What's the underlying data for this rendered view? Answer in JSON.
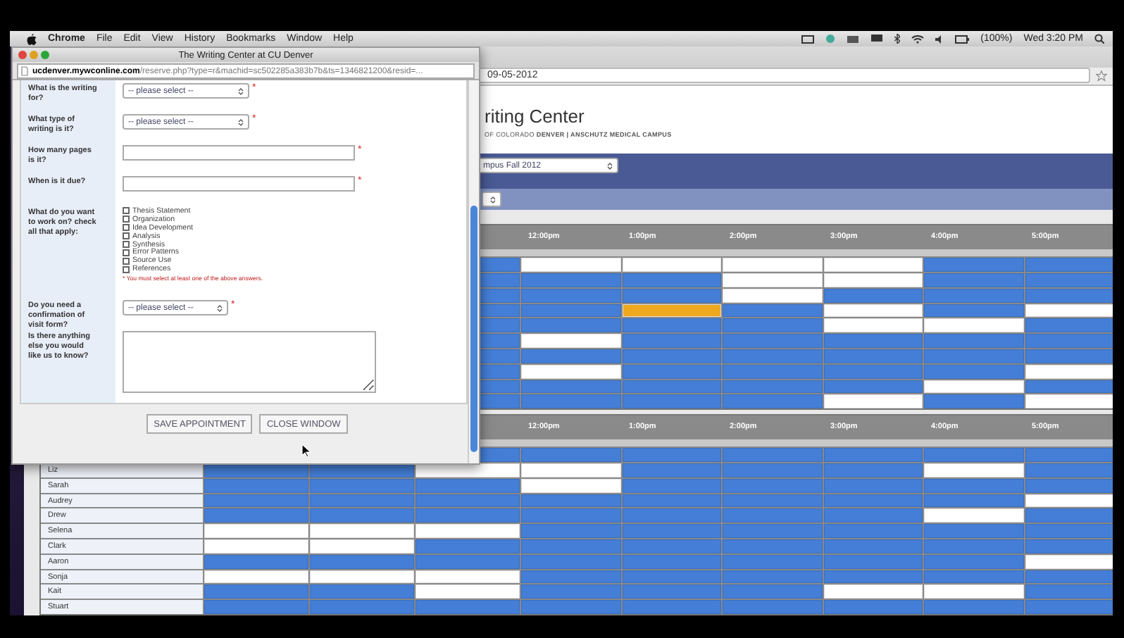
{
  "menu_bar": {
    "app": "Chrome",
    "menus": [
      "File",
      "Edit",
      "View",
      "History",
      "Bookmarks",
      "Window",
      "Help"
    ],
    "battery": "(100%)",
    "clock": "Wed 3:20 PM"
  },
  "browser": {
    "address_fragment": "09-05-2012",
    "title": "riting Center",
    "subtitle": "OF COLORADO **DENVER | ANSCHUTZ MEDICAL CAMPUS**",
    "term_select": "mpus Fall 2012"
  },
  "grids": [
    {
      "times": [
        "12:00pm",
        "1:00pm",
        "2:00pm",
        "3:00pm",
        "4:00pm",
        "5:00pm"
      ],
      "rows": [
        {
          "slots": [
            {
              "booked": true,
              "selected": false
            },
            {
              "booked": false,
              "selected": false
            },
            {
              "booked": false,
              "selected": false
            },
            {
              "booked": false,
              "selected": false
            },
            {
              "booked": false,
              "selected": false
            },
            {
              "booked": true,
              "selected": false
            },
            {
              "booked": true,
              "selected": false
            }
          ]
        },
        {
          "slots": [
            {
              "booked": true,
              "selected": false
            },
            {
              "booked": true,
              "selected": false
            },
            {
              "booked": true,
              "selected": false
            },
            {
              "booked": false,
              "selected": false
            },
            {
              "booked": false,
              "selected": false
            },
            {
              "booked": true,
              "selected": false
            },
            {
              "booked": true,
              "selected": false
            }
          ]
        },
        {
          "slots": [
            {
              "booked": true,
              "selected": false
            },
            {
              "booked": true,
              "selected": false
            },
            {
              "booked": true,
              "selected": false
            },
            {
              "booked": false,
              "selected": false
            },
            {
              "booked": true,
              "selected": false
            },
            {
              "booked": true,
              "selected": false
            },
            {
              "booked": true,
              "selected": false
            }
          ]
        },
        {
          "slots": [
            {
              "booked": true,
              "selected": false
            },
            {
              "booked": true,
              "selected": false
            },
            {
              "booked": false,
              "selected": true
            },
            {
              "booked": true,
              "selected": false
            },
            {
              "booked": false,
              "selected": false
            },
            {
              "booked": true,
              "selected": false
            },
            {
              "booked": false,
              "selected": false
            }
          ]
        },
        {
          "slots": [
            {
              "booked": true,
              "selected": false
            },
            {
              "booked": true,
              "selected": false
            },
            {
              "booked": true,
              "selected": false
            },
            {
              "booked": true,
              "selected": false
            },
            {
              "booked": false,
              "selected": false
            },
            {
              "booked": false,
              "selected": false
            },
            {
              "booked": true,
              "selected": false
            }
          ]
        },
        {
          "slots": [
            {
              "booked": true,
              "selected": false
            },
            {
              "booked": false,
              "selected": false
            },
            {
              "booked": true,
              "selected": false
            },
            {
              "booked": true,
              "selected": false
            },
            {
              "booked": true,
              "selected": false
            },
            {
              "booked": true,
              "selected": false
            },
            {
              "booked": true,
              "selected": false
            }
          ]
        },
        {
          "slots": [
            {
              "booked": true,
              "selected": false
            },
            {
              "booked": true,
              "selected": false
            },
            {
              "booked": true,
              "selected": false
            },
            {
              "booked": true,
              "selected": false
            },
            {
              "booked": true,
              "selected": false
            },
            {
              "booked": true,
              "selected": false
            },
            {
              "booked": true,
              "selected": false
            }
          ]
        },
        {
          "slots": [
            {
              "booked": true,
              "selected": false
            },
            {
              "booked": false,
              "selected": false
            },
            {
              "booked": true,
              "selected": false
            },
            {
              "booked": true,
              "selected": false
            },
            {
              "booked": true,
              "selected": false
            },
            {
              "booked": true,
              "selected": false
            },
            {
              "booked": false,
              "selected": false
            }
          ]
        },
        {
          "slots": [
            {
              "booked": true,
              "selected": false
            },
            {
              "booked": true,
              "selected": false
            },
            {
              "booked": true,
              "selected": false
            },
            {
              "booked": true,
              "selected": false
            },
            {
              "booked": true,
              "selected": false
            },
            {
              "booked": false,
              "selected": false
            },
            {
              "booked": true,
              "selected": false
            }
          ]
        },
        {
          "slots": [
            {
              "booked": true,
              "selected": false
            },
            {
              "booked": true,
              "selected": false
            },
            {
              "booked": true,
              "selected": false
            },
            {
              "booked": true,
              "selected": false
            },
            {
              "booked": false,
              "selected": false
            },
            {
              "booked": true,
              "selected": false
            },
            {
              "booked": false,
              "selected": false
            }
          ]
        }
      ]
    },
    {
      "times": [
        "12:00pm",
        "1:00pm",
        "2:00pm",
        "3:00pm",
        "4:00pm",
        "5:00pm"
      ],
      "rows": [
        {
          "slots": [
            {
              "booked": true,
              "selected": false
            },
            {
              "booked": true,
              "selected": false
            },
            {
              "booked": true,
              "selected": false
            },
            {
              "booked": true,
              "selected": false
            },
            {
              "booked": true,
              "selected": false
            },
            {
              "booked": true,
              "selected": false
            },
            {
              "booked": true,
              "selected": false
            }
          ]
        },
        {
          "name": "Liz",
          "slots": [
            {
              "booked": true,
              "selected": false
            },
            {
              "booked": true,
              "selected": false
            },
            {
              "booked": false,
              "selected": false
            },
            {
              "booked": false,
              "selected": false
            },
            {
              "booked": true,
              "selected": false
            },
            {
              "booked": true,
              "selected": false
            },
            {
              "booked": true,
              "selected": false
            },
            {
              "booked": false,
              "selected": false
            },
            {
              "booked": true,
              "selected": false
            }
          ]
        },
        {
          "name": "Sarah",
          "slots": [
            {
              "booked": true,
              "selected": false
            },
            {
              "booked": true,
              "selected": false
            },
            {
              "booked": true,
              "selected": false
            },
            {
              "booked": false,
              "selected": false
            },
            {
              "booked": true,
              "selected": false
            },
            {
              "booked": true,
              "selected": false
            },
            {
              "booked": true,
              "selected": false
            },
            {
              "booked": true,
              "selected": false
            },
            {
              "booked": true,
              "selected": false
            }
          ]
        },
        {
          "name": "Audrey",
          "slots": [
            {
              "booked": true,
              "selected": false
            },
            {
              "booked": true,
              "selected": false
            },
            {
              "booked": true,
              "selected": false
            },
            {
              "booked": true,
              "selected": false
            },
            {
              "booked": true,
              "selected": false
            },
            {
              "booked": true,
              "selected": false
            },
            {
              "booked": true,
              "selected": false
            },
            {
              "booked": true,
              "selected": false
            },
            {
              "booked": false,
              "selected": false
            }
          ]
        },
        {
          "name": "Drew",
          "slots": [
            {
              "booked": true,
              "selected": false
            },
            {
              "booked": true,
              "selected": false
            },
            {
              "booked": true,
              "selected": false
            },
            {
              "booked": true,
              "selected": false
            },
            {
              "booked": true,
              "selected": false
            },
            {
              "booked": true,
              "selected": false
            },
            {
              "booked": true,
              "selected": false
            },
            {
              "booked": false,
              "selected": false
            },
            {
              "booked": true,
              "selected": false
            }
          ]
        },
        {
          "name": "Selena",
          "slots": [
            {
              "booked": false,
              "selected": false
            },
            {
              "booked": false,
              "selected": false
            },
            {
              "booked": false,
              "selected": false
            },
            {
              "booked": true,
              "selected": false
            },
            {
              "booked": true,
              "selected": false
            },
            {
              "booked": true,
              "selected": false
            },
            {
              "booked": true,
              "selected": false
            },
            {
              "booked": true,
              "selected": false
            },
            {
              "booked": true,
              "selected": false
            }
          ]
        },
        {
          "name": "Clark",
          "slots": [
            {
              "booked": false,
              "selected": false
            },
            {
              "booked": false,
              "selected": false
            },
            {
              "booked": true,
              "selected": false
            },
            {
              "booked": true,
              "selected": false
            },
            {
              "booked": true,
              "selected": false
            },
            {
              "booked": true,
              "selected": false
            },
            {
              "booked": true,
              "selected": false
            },
            {
              "booked": true,
              "selected": false
            },
            {
              "booked": true,
              "selected": false
            }
          ]
        },
        {
          "name": "Aaron",
          "slots": [
            {
              "booked": true,
              "selected": false
            },
            {
              "booked": true,
              "selected": false
            },
            {
              "booked": true,
              "selected": false
            },
            {
              "booked": true,
              "selected": false
            },
            {
              "booked": true,
              "selected": false
            },
            {
              "booked": true,
              "selected": false
            },
            {
              "booked": true,
              "selected": false
            },
            {
              "booked": true,
              "selected": false
            },
            {
              "booked": false,
              "selected": false
            }
          ]
        },
        {
          "name": "Sonja",
          "slots": [
            {
              "booked": false,
              "selected": false
            },
            {
              "booked": false,
              "selected": false
            },
            {
              "booked": false,
              "selected": false
            },
            {
              "booked": true,
              "selected": false
            },
            {
              "booked": true,
              "selected": false
            },
            {
              "booked": true,
              "selected": false
            },
            {
              "booked": true,
              "selected": false
            },
            {
              "booked": true,
              "selected": false
            },
            {
              "booked": true,
              "selected": false
            }
          ]
        },
        {
          "name": "Kait",
          "slots": [
            {
              "booked": true,
              "selected": false
            },
            {
              "booked": true,
              "selected": false
            },
            {
              "booked": false,
              "selected": false
            },
            {
              "booked": true,
              "selected": false
            },
            {
              "booked": true,
              "selected": false
            },
            {
              "booked": true,
              "selected": false
            },
            {
              "booked": false,
              "selected": false
            },
            {
              "booked": false,
              "selected": false
            },
            {
              "booked": true,
              "selected": false
            }
          ]
        },
        {
          "name": "Stuart",
          "slots": [
            {
              "booked": true,
              "selected": false
            },
            {
              "booked": true,
              "selected": false
            },
            {
              "booked": true,
              "selected": false
            },
            {
              "booked": true,
              "selected": false
            },
            {
              "booked": true,
              "selected": false
            },
            {
              "booked": true,
              "selected": false
            },
            {
              "booked": true,
              "selected": false
            },
            {
              "booked": true,
              "selected": false
            },
            {
              "booked": true,
              "selected": false
            }
          ]
        }
      ]
    }
  ],
  "popup": {
    "title": "The Writing Center at CU Denver",
    "url_host": "ucdenver.mywconline.com",
    "url_path": "/reserve.php?type=r&machid=sc502285a383b7b&ts=1346821200&resid=...",
    "questions": [
      {
        "kind": "select",
        "label": "What is the writing for?",
        "value": "-- please select --",
        "required_mark": "*"
      },
      {
        "kind": "select",
        "label": "What type of writing is it?",
        "value": "-- please select --",
        "required_mark": "*"
      },
      {
        "kind": "text",
        "label": "How many pages is it?",
        "required_mark": "*"
      },
      {
        "kind": "text",
        "label": "When is it due?",
        "required_mark": "*"
      },
      {
        "kind": "checklist",
        "label": "What do you want to work on? check all that apply:",
        "note": "* You must select at least one of the above answers.",
        "options": [
          {
            "label": "Thesis Statement",
            "checked": false
          },
          {
            "label": "Organization",
            "checked": false
          },
          {
            "label": "Idea Development",
            "checked": false
          },
          {
            "label": "Analysis",
            "checked": false
          },
          {
            "label": "Synthesis",
            "checked": false
          },
          {
            "label": "Error Patterns",
            "checked": false
          },
          {
            "label": "Source Use",
            "checked": false
          },
          {
            "label": "References",
            "checked": false
          }
        ]
      },
      {
        "kind": "select",
        "label": "Do you need a confirmation of visit form?",
        "value": "-- please select --",
        "required_mark": "*"
      },
      {
        "kind": "textarea",
        "label": "Is there anything else you would like us to know?"
      }
    ],
    "buttons": [
      "SAVE APPOINTMENT",
      "CLOSE WINDOW"
    ]
  }
}
